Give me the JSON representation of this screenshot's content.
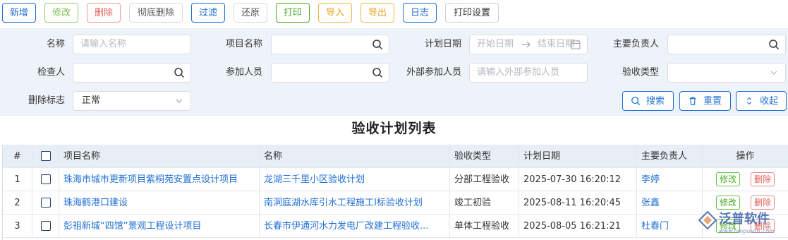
{
  "toolbar": {
    "add": "新增",
    "edit": "修改",
    "delete": "删除",
    "purge": "彻底删除",
    "filter": "过滤",
    "restore": "还原",
    "print": "打印",
    "import": "导入",
    "export": "导出",
    "log": "日志",
    "print_settings": "打印设置"
  },
  "filters": {
    "name_label": "名称",
    "name_placeholder": "请输入名称",
    "project_label": "项目名称",
    "plan_date_label": "计划日期",
    "date_start_placeholder": "开始日期",
    "date_end_placeholder": "结束日期",
    "owner_label": "主要负责人",
    "inspector_label": "检查人",
    "participants_label": "参加人员",
    "external_label": "外部参加人员",
    "external_placeholder": "请输入外部参加人员",
    "acceptance_type_label": "验收类型",
    "delete_flag_label": "删除标志",
    "delete_flag_value": "正常"
  },
  "actions": {
    "search": "搜索",
    "reset": "重置",
    "collapse": "收起"
  },
  "table": {
    "title": "验收计划列表",
    "columns": {
      "index": "#",
      "project": "项目名称",
      "name": "名称",
      "type": "验收类型",
      "date": "计划日期",
      "owner": "主要负责人",
      "ops": "操作"
    },
    "rows": [
      {
        "index": "1",
        "project": "珠海市城市更新项目紫桐苑安置点设计项目",
        "name": "龙湖三千里小区验收计划",
        "type": "分部工程验收",
        "date": "2025-07-30 16:20:12",
        "owner": "李婷",
        "edit": "修改",
        "delete": "删除"
      },
      {
        "index": "2",
        "project": "珠海鹤港口建设",
        "name": "南洞庭湖水库引水工程施工I标验收计划",
        "type": "竣工初验",
        "date": "2025-08-11 16:20:45",
        "owner": "张鑫",
        "edit": "修改",
        "delete": "删除"
      },
      {
        "index": "3",
        "project": "彭祖新城“四馆”景观工程设计项目",
        "name": "长春市伊通河水力发电厂改建工程验收...",
        "type": "单体工程验收",
        "date": "2025-08-05 16:21:21",
        "owner": "杜春门",
        "edit": "修改",
        "delete": "删除"
      }
    ]
  },
  "watermark": {
    "brand": "泛普软件",
    "url": "www.fanpusoft.com"
  }
}
